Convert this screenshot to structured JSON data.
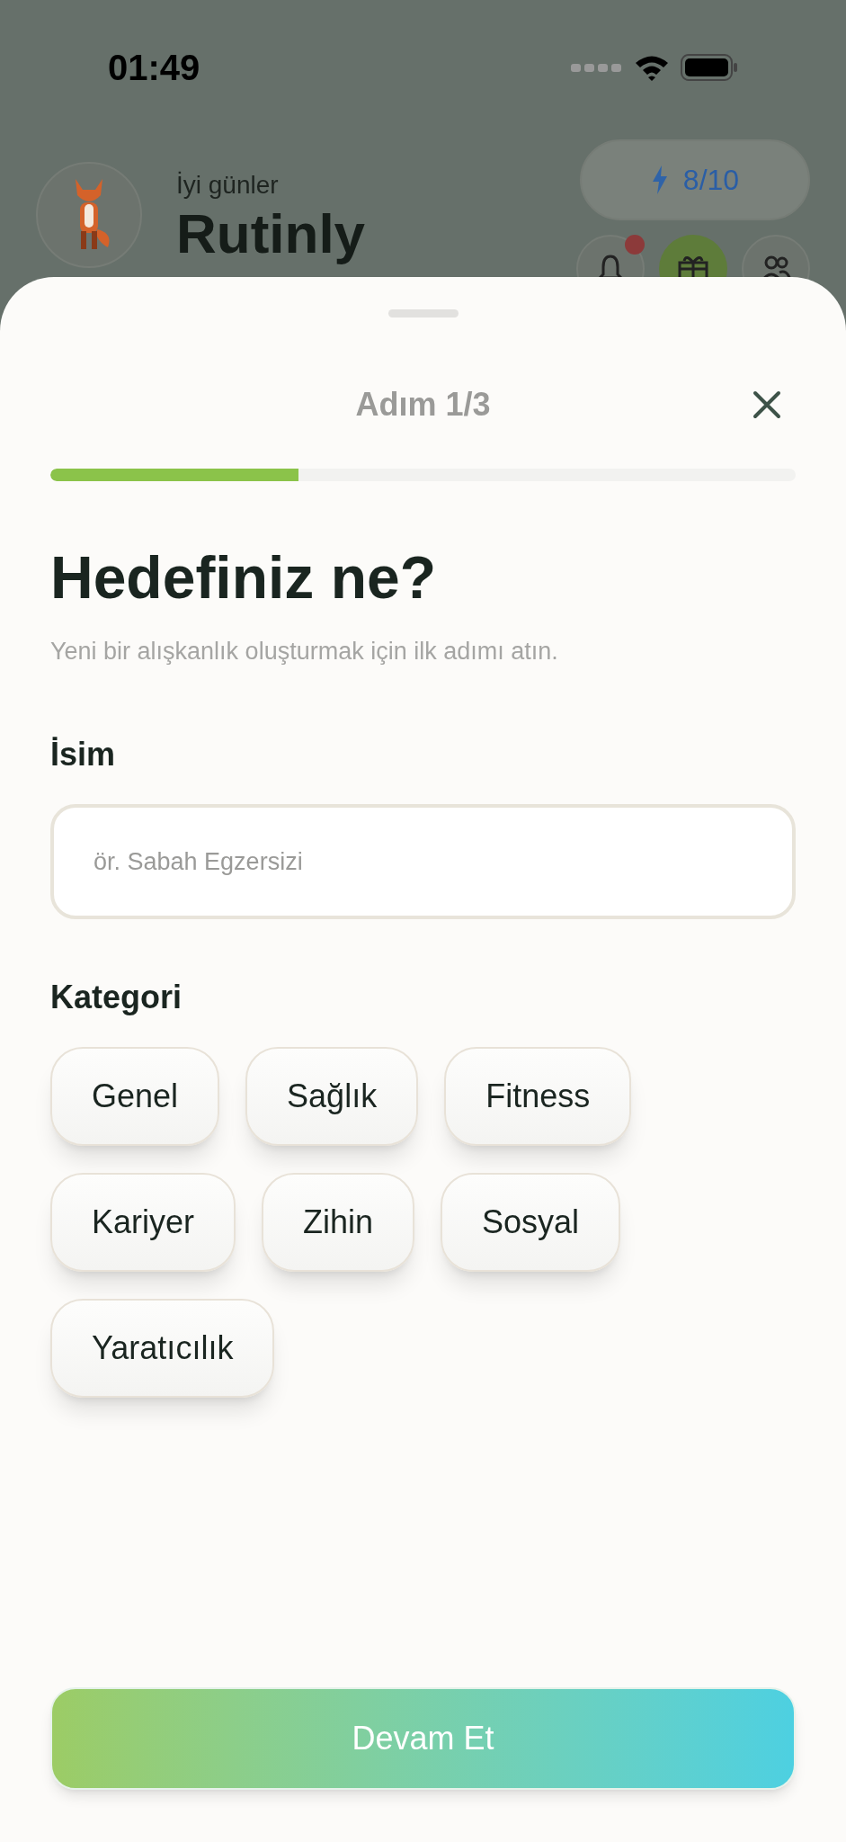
{
  "status_bar": {
    "time": "01:49"
  },
  "header": {
    "greeting": "İyi günler",
    "app_name": "Rutinly",
    "energy": "8/10",
    "has_notification": true
  },
  "sheet": {
    "step": "Adım 1/3",
    "progress": {
      "level": 0.333
    },
    "title": "Hedefiniz ne?",
    "subtitle": "Yeni bir alışkanlık oluşturmak için ilk adımı atın.",
    "name_field": {
      "label": "İsim",
      "placeholder": "ör. Sabah Egzersizi"
    },
    "category_label": "Kategori",
    "categories": [
      {
        "label": "Genel",
        "selected": false
      },
      {
        "label": "Sağlık",
        "selected": false
      },
      {
        "label": "Fitness",
        "selected": false
      },
      {
        "label": "Kariyer",
        "selected": false
      },
      {
        "label": "Zihin",
        "selected": false
      },
      {
        "label": "Sosyal",
        "selected": false
      },
      {
        "label": "Yaratıcılık",
        "selected": false
      }
    ],
    "continue_button": "Devam Et"
  }
}
